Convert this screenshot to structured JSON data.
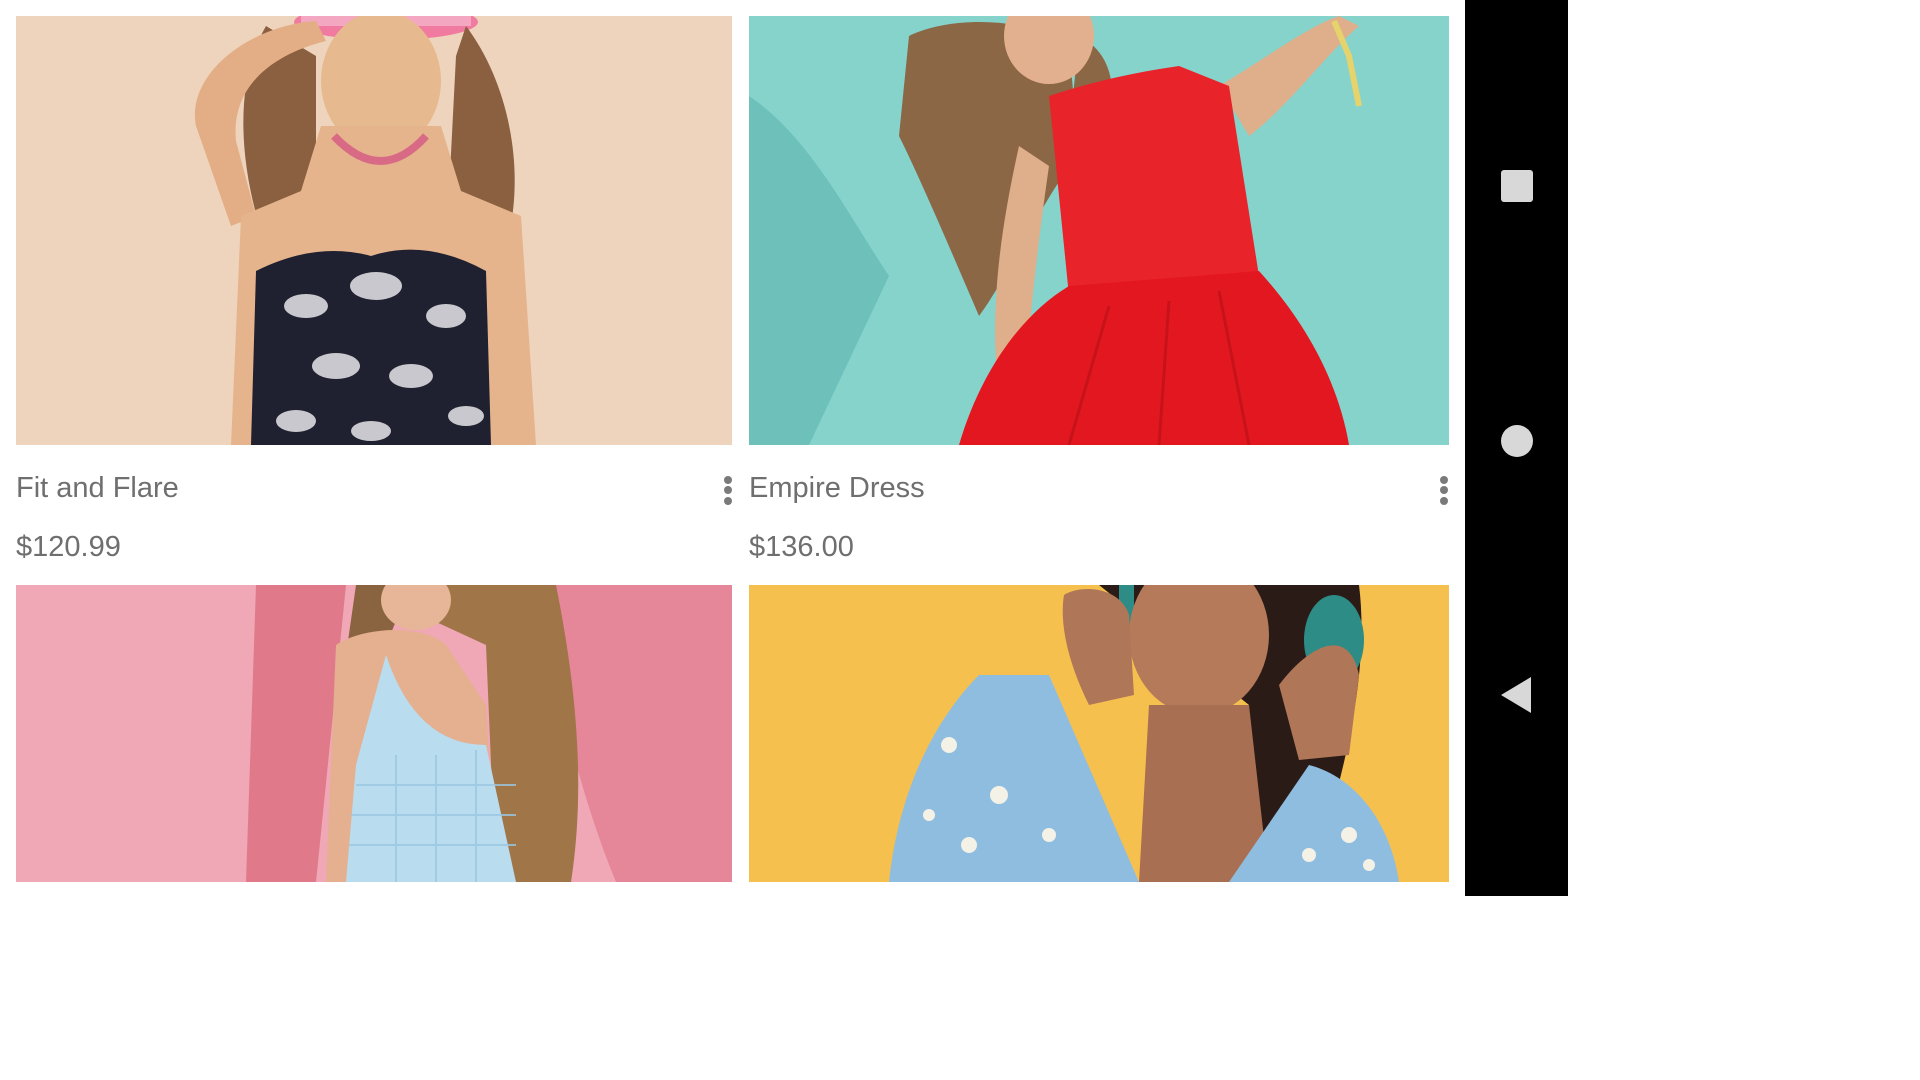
{
  "products": [
    {
      "title": "Fit and Flare",
      "price": "$120.99",
      "image": "woman-in-strapless-floral-dress-on-beige"
    },
    {
      "title": "Empire Dress",
      "price": "$136.00",
      "image": "woman-in-red-dress-on-teal"
    },
    {
      "title": "",
      "price": "",
      "image": "woman-in-blue-gingham-top-on-pink"
    },
    {
      "title": "",
      "price": "",
      "image": "woman-with-headphones-on-yellow"
    }
  ],
  "icons": {
    "more": "more-vert-icon",
    "recents": "square-recents-icon",
    "home": "circle-home-icon",
    "back": "triangle-back-icon"
  },
  "colors": {
    "text": "#6f6f6f",
    "nav_bg": "#000000",
    "nav_icon": "#d8d8d8"
  }
}
